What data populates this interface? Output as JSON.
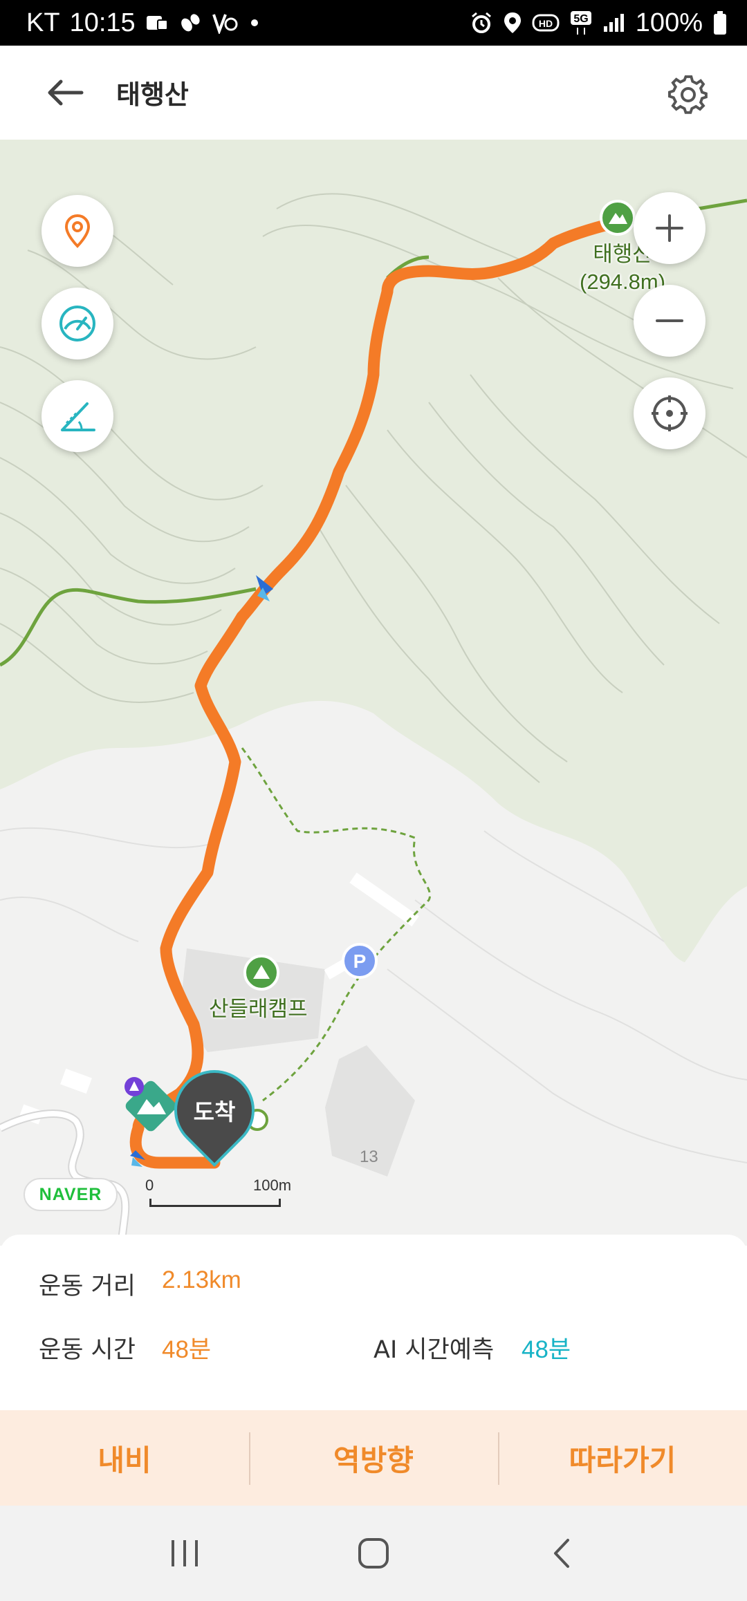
{
  "status_bar": {
    "carrier": "KT",
    "time": "10:15",
    "battery": "100%",
    "left_icons": [
      "media-icon",
      "steps-icon",
      "activity-icon",
      "dot-icon"
    ],
    "right_icons": [
      "alarm-icon",
      "location-icon",
      "hd-icon",
      "5g-icon",
      "signal-icon",
      "battery-icon"
    ]
  },
  "header": {
    "title": "태행산"
  },
  "map": {
    "peak_name": "태행산",
    "peak_elevation": "(294.8m)",
    "camp_label": "산들래캠프",
    "arrival_label": "도착",
    "contour_number": "13",
    "brand": "NAVER",
    "scale_start": "0",
    "scale_end": "100m",
    "colors": {
      "route": "#f47b27",
      "trail": "#6ea33e",
      "forest": "#e9eee2",
      "parking": "#7b9cf0"
    }
  },
  "stats": {
    "distance_label": "운동 거리",
    "distance_value": "2.13km",
    "time_label": "운동 시간",
    "time_value": "48분",
    "ai_label": "AI 시간예측",
    "ai_value": "48분"
  },
  "actions": {
    "navi": "내비",
    "reverse": "역방향",
    "follow": "따라가기"
  },
  "navbar": {
    "recent_icon": "recent-apps-icon",
    "home_icon": "home-icon",
    "back_icon": "back-icon"
  }
}
